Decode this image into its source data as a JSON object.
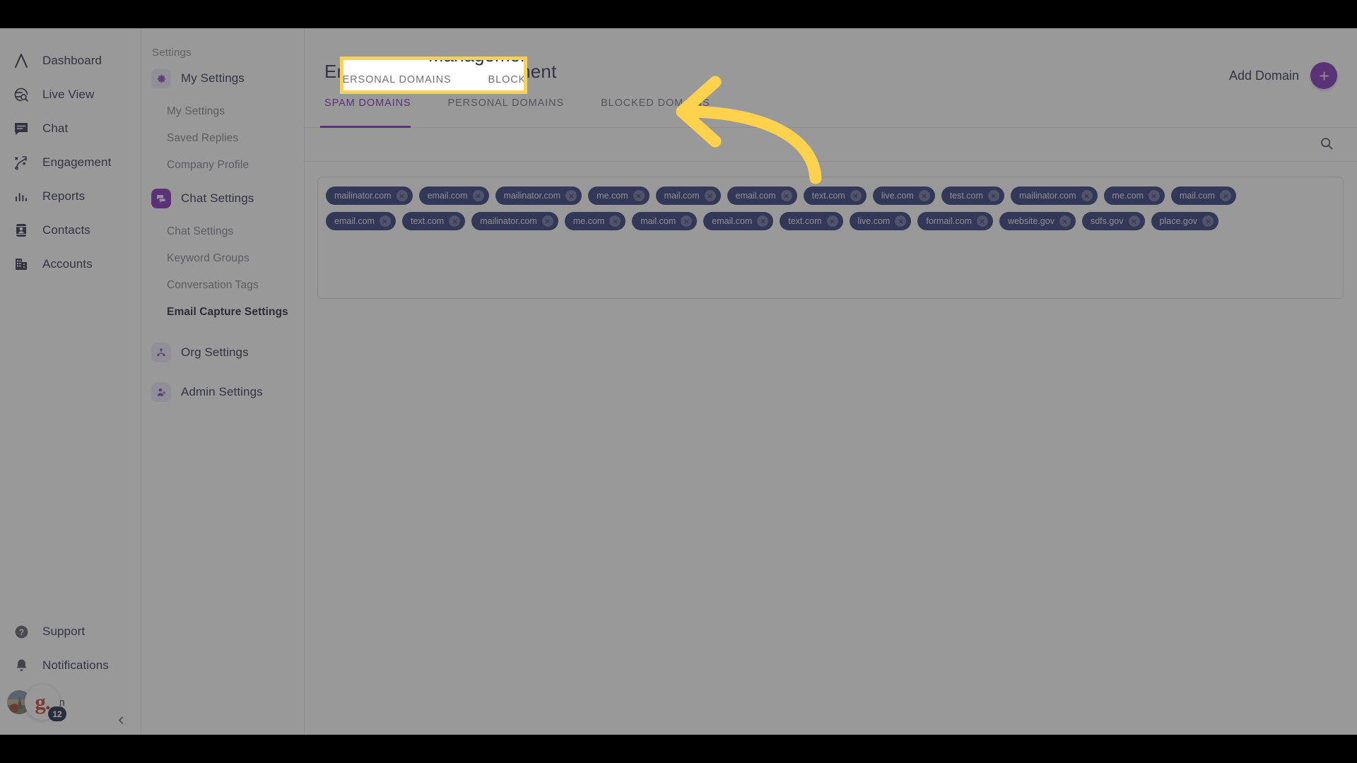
{
  "nav": {
    "items": [
      {
        "label": "Dashboard",
        "icon": "logo-chevron-icon"
      },
      {
        "label": "Live View",
        "icon": "globe-search-icon"
      },
      {
        "label": "Chat",
        "icon": "chat-bubble-icon"
      },
      {
        "label": "Engagement",
        "icon": "engagement-flow-icon"
      },
      {
        "label": "Reports",
        "icon": "bar-chart-icon"
      },
      {
        "label": "Contacts",
        "icon": "contact-card-icon"
      },
      {
        "label": "Accounts",
        "icon": "building-icon"
      }
    ],
    "bottom_items": [
      {
        "label": "Support",
        "icon": "question-circle-icon"
      },
      {
        "label": "Notifications",
        "icon": "bell-icon"
      }
    ],
    "user": {
      "name": "Ngan",
      "badge_letter": "g.",
      "notification_count": "12"
    },
    "collapse_icon": "chevron-left-icon"
  },
  "settings": {
    "heading": "Settings",
    "groups": [
      {
        "title": "My Settings",
        "icon": "gear-icon",
        "active": false,
        "items": [
          {
            "label": "My Settings",
            "selected": false
          },
          {
            "label": "Saved Replies",
            "selected": false
          },
          {
            "label": "Company Profile",
            "selected": false
          }
        ]
      },
      {
        "title": "Chat Settings",
        "icon": "chat-settings-icon",
        "active": true,
        "items": [
          {
            "label": "Chat Settings",
            "selected": false
          },
          {
            "label": "Keyword Groups",
            "selected": false
          },
          {
            "label": "Conversation Tags",
            "selected": false
          },
          {
            "label": "Email Capture Settings",
            "selected": true
          }
        ]
      },
      {
        "title": "Org Settings",
        "icon": "org-users-icon",
        "active": false,
        "items": []
      },
      {
        "title": "Admin Settings",
        "icon": "admin-user-icon",
        "active": false,
        "items": []
      }
    ]
  },
  "main": {
    "title": "Email Capture Management",
    "tabs": [
      {
        "label": "SPAM DOMAINS",
        "active": true
      },
      {
        "label": "PERSONAL DOMAINS",
        "active": false
      },
      {
        "label": "BLOCKED DOMAINS",
        "active": false
      }
    ],
    "add_domain_label": "Add Domain",
    "add_domain_icon": "plus-icon",
    "search_icon": "search-icon",
    "remove_chip_icon": "close-circle-icon",
    "domain_rows": [
      [
        "mailinator.com",
        "email.com",
        "mailinator.com",
        "me.com",
        "mail.com",
        "email.com",
        "text.com",
        "live.com",
        "test.com",
        "mailinator.com",
        "me.com",
        "mail.com"
      ],
      [
        "email.com",
        "text.com",
        "mailinator.com",
        "me.com",
        "mail.com",
        "email.com",
        "text.com",
        "live.com",
        "formail.com",
        "website.gov",
        "sdfs.gov",
        "place.gov"
      ]
    ]
  },
  "overlay": {
    "spotlight_tabs": [
      {
        "label": "PERSONAL DOMAINS"
      },
      {
        "label": "BLOCKED DOMAINS"
      }
    ],
    "title_sliver": "Management",
    "highlight_color": "#ffd24d",
    "arrow_icon": "curved-arrow-left-icon"
  },
  "colors": {
    "accent_purple": "#7c29b8",
    "chip_navy": "#2b3275",
    "highlight_yellow": "#ffd24d"
  }
}
